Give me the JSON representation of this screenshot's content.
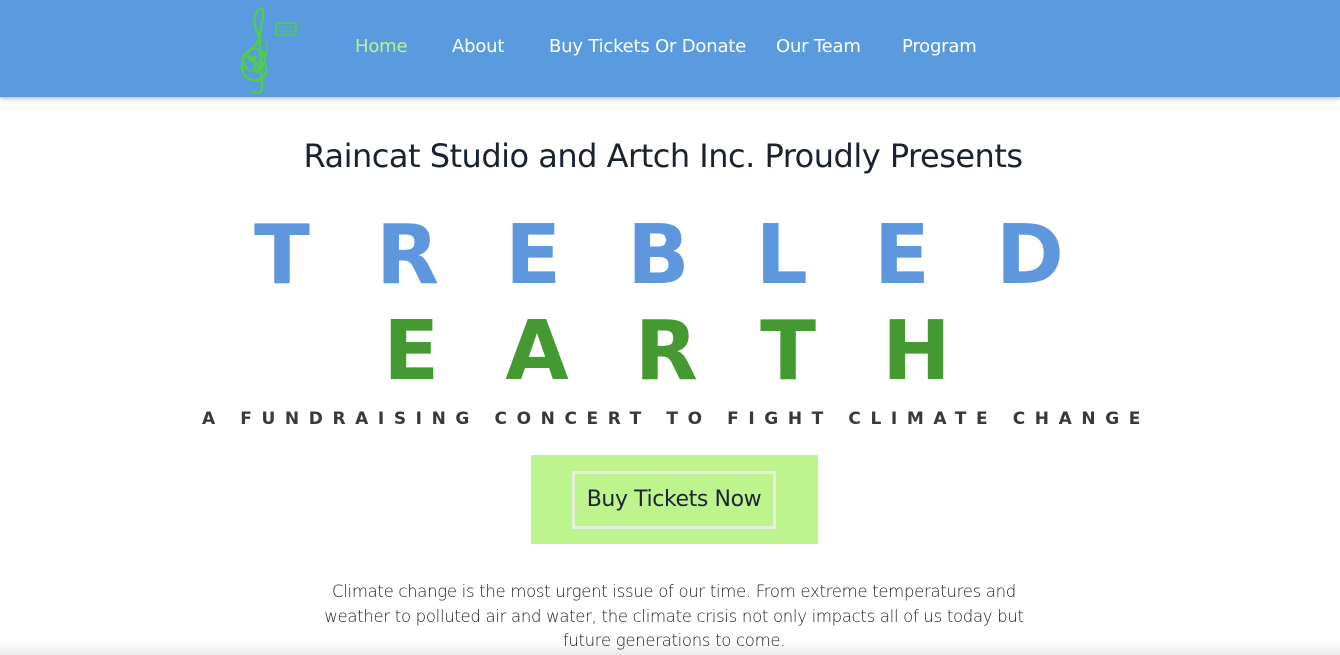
{
  "nav": {
    "items": [
      {
        "label": "Home",
        "active": true
      },
      {
        "label": "About",
        "active": false
      },
      {
        "label": "Buy Tickets Or Donate",
        "active": false
      },
      {
        "label": "Our Team",
        "active": false
      },
      {
        "label": "Program",
        "active": false
      }
    ]
  },
  "logo": {
    "icon": "treble-clef-earth-logo-icon"
  },
  "hero": {
    "presents": "Raincat Studio and Artch Inc. Proudly Presents",
    "title_line1": "TREBLED",
    "title_line2": "EARTH",
    "subtitle": "A FUNDRAISING CONCERT TO FIGHT CLIMATE CHANGE",
    "cta_label": "Buy Tickets Now"
  },
  "intro": {
    "text": "Climate change is the most urgent issue of our time. From extreme temperatures and weather to polluted air and water, the climate crisis not only impacts all of us today but future generations to come."
  },
  "colors": {
    "header": "#5a9bdf",
    "nav_active": "#b9f58e",
    "title_blue": "#5e97de",
    "title_green": "#449a31",
    "cta_background": "#bdf48e"
  }
}
